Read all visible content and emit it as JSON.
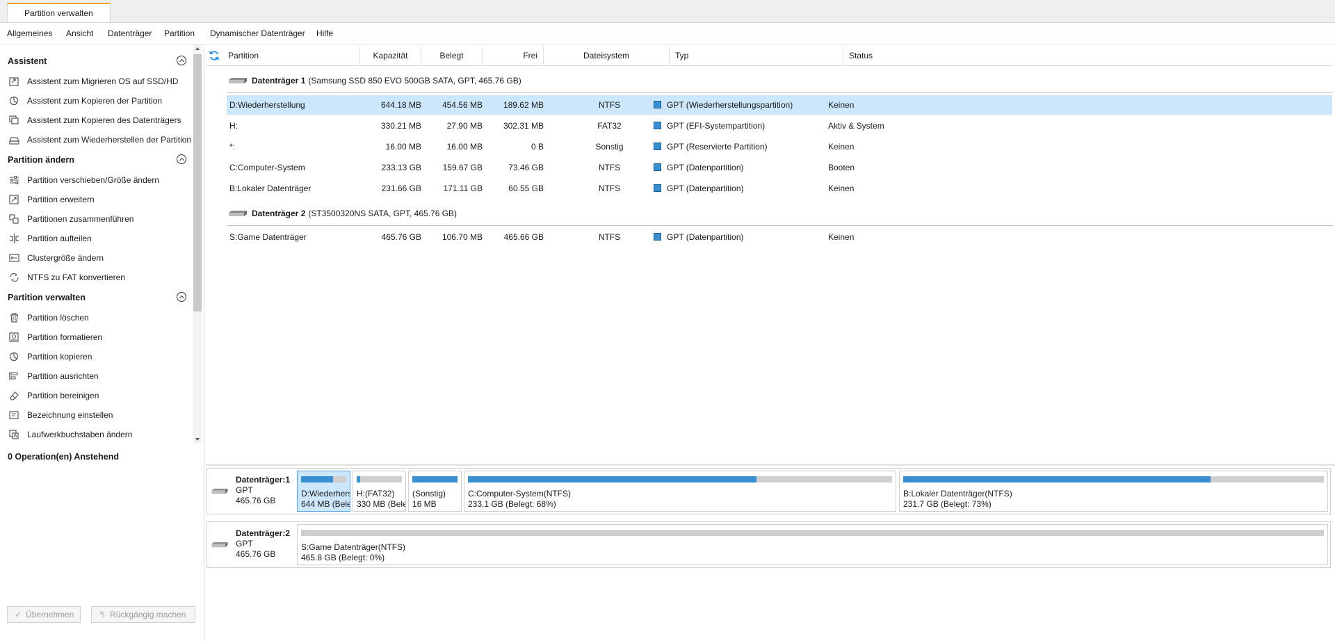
{
  "tab": {
    "label": "Partition verwalten"
  },
  "menu": [
    "Allgemeines",
    "Ansicht",
    "Datenträger",
    "Partition",
    "Dynamischer Datenträger",
    "Hilfe"
  ],
  "sidebar": {
    "sections": [
      {
        "title": "Assistent",
        "items": [
          {
            "label": "Assistent zum Migrieren OS auf SSD/HD",
            "icon": "migrate-os-icon"
          },
          {
            "label": "Assistent zum Kopieren der Partition",
            "icon": "copy-partition-wizard-icon"
          },
          {
            "label": "Assistent zum Kopieren des Datenträgers",
            "icon": "copy-disk-wizard-icon"
          },
          {
            "label": "Assistent zum Wiederherstellen der Partition",
            "icon": "recover-partition-icon"
          }
        ]
      },
      {
        "title": "Partition ändern",
        "items": [
          {
            "label": "Partition verschieben/Größe ändern",
            "icon": "resize-sliders-icon"
          },
          {
            "label": "Partition erweitern",
            "icon": "extend-icon"
          },
          {
            "label": "Partitionen zusammenführen",
            "icon": "merge-icon"
          },
          {
            "label": "Partition aufteilen",
            "icon": "split-icon"
          },
          {
            "label": "Clustergröße ändern",
            "icon": "cluster-icon"
          },
          {
            "label": "NTFS zu FAT konvertieren",
            "icon": "convert-icon"
          }
        ]
      },
      {
        "title": "Partition verwalten",
        "items": [
          {
            "label": "Partition löschen",
            "icon": "trash-icon"
          },
          {
            "label": "Partition formatieren",
            "icon": "format-icon"
          },
          {
            "label": "Partition kopieren",
            "icon": "copy-icon"
          },
          {
            "label": "Partition ausrichten",
            "icon": "align-icon"
          },
          {
            "label": "Partition bereinigen",
            "icon": "eraser-icon"
          },
          {
            "label": "Bezeichnung einstellen",
            "icon": "label-icon"
          },
          {
            "label": "Laufwerkbuchstaben ändern",
            "icon": "drive-letter-icon"
          }
        ]
      }
    ],
    "pending": "0 Operation(en) Anstehend",
    "apply_label": "Übernehmen",
    "undo_label": "Rückgängig machen"
  },
  "table": {
    "headers": [
      "Partition",
      "Kapazität",
      "Belegt",
      "Frei",
      "Dateisystem",
      "Typ",
      "Status"
    ],
    "disks": [
      {
        "name": "Datenträger 1",
        "detail": "(Samsung SSD 850 EVO 500GB SATA, GPT, 465.76 GB)",
        "rows": [
          {
            "partition": "D:Wiederherstellung",
            "capacity": "644.18 MB",
            "used": "454.56 MB",
            "free": "189.62 MB",
            "fs": "NTFS",
            "type": "GPT (Wiederherstellungspartition)",
            "status": "Keinen",
            "selected": true
          },
          {
            "partition": "H:",
            "capacity": "330.21 MB",
            "used": "27.90 MB",
            "free": "302.31 MB",
            "fs": "FAT32",
            "type": "GPT (EFI-Systempartition)",
            "status": "Aktiv & System"
          },
          {
            "partition": "*:",
            "capacity": "16.00 MB",
            "used": "16.00 MB",
            "free": "0 B",
            "fs": "Sonstig",
            "type": "GPT (Reservierte Partition)",
            "status": "Keinen"
          },
          {
            "partition": "C:Computer-System",
            "capacity": "233.13 GB",
            "used": "159.67 GB",
            "free": "73.46 GB",
            "fs": "NTFS",
            "type": "GPT (Datenpartition)",
            "status": "Booten"
          },
          {
            "partition": "B:Lokaler Datenträger",
            "capacity": "231.66 GB",
            "used": "171.11 GB",
            "free": "60.55 GB",
            "fs": "NTFS",
            "type": "GPT (Datenpartition)",
            "status": "Keinen"
          }
        ]
      },
      {
        "name": "Datenträger 2",
        "detail": "(ST3500320NS SATA, GPT, 465.76 GB)",
        "rows": [
          {
            "partition": "S:Game Datenträger",
            "capacity": "465.76 GB",
            "used": "106.70 MB",
            "free": "465.66 GB",
            "fs": "NTFS",
            "type": "GPT (Datenpartition)",
            "status": "Keinen"
          }
        ]
      }
    ]
  },
  "diskmap": [
    {
      "title": "Datenträger:1",
      "style": "GPT",
      "size": "465.76 GB",
      "partitions": [
        {
          "line1": "D:Wiederhers",
          "line2": "644 MB (Bele",
          "used_fraction": 0.71,
          "selected": true
        },
        {
          "line1": "H:(FAT32)",
          "line2": "330 MB (Bele",
          "used_fraction": 0.08
        },
        {
          "line1": "(Sonstig)",
          "line2": "16 MB",
          "used_fraction": 1.0
        },
        {
          "line1": "C:Computer-System(NTFS)",
          "line2": "233.1 GB (Belegt: 68%)",
          "used_fraction": 0.68
        },
        {
          "line1": "B:Lokaler Datenträger(NTFS)",
          "line2": "231.7 GB (Belegt: 73%)",
          "used_fraction": 0.73
        }
      ]
    },
    {
      "title": "Datenträger:2",
      "style": "GPT",
      "size": "465.76 GB",
      "partitions": [
        {
          "line1": "S:Game Datenträger(NTFS)",
          "line2": "465.8 GB (Belegt: 0%)",
          "used_fraction": 0.0
        }
      ]
    }
  ],
  "colors": {
    "accent": "#f5a623",
    "used_bar": "#3a8fd0",
    "selection": "#cce6fb",
    "refresh": "#2b8de0"
  }
}
